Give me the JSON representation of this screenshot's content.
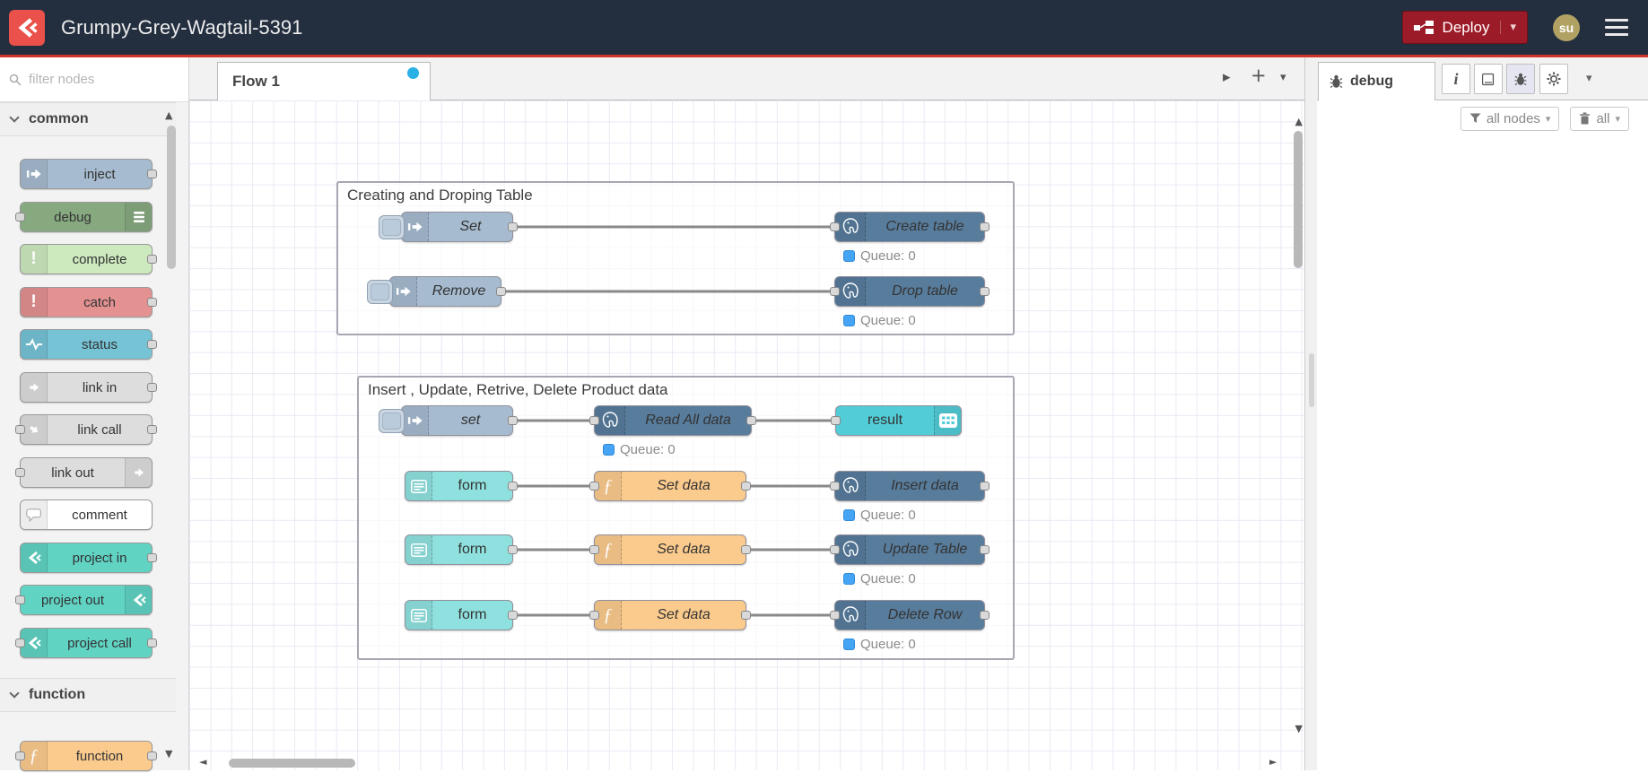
{
  "header": {
    "title": "Grumpy-Grey-Wagtail-5391",
    "deploy_label": "Deploy",
    "avatar_initials": "su",
    "colors": {
      "header_bg": "#232e3f",
      "header_underline": "#cf352c",
      "logo_red": "#e9514a",
      "deploy_red": "#9c1b28",
      "avatar_khaki": "#b1a264"
    }
  },
  "palette": {
    "filter_placeholder": "filter nodes",
    "categories": [
      {
        "label": "common",
        "nodes": [
          {
            "label": "inject",
            "color": "#a6bbcf"
          },
          {
            "label": "debug",
            "color": "#87a980"
          },
          {
            "label": "complete",
            "color": "#cdeabf"
          },
          {
            "label": "catch",
            "color": "#e49191"
          },
          {
            "label": "status",
            "color": "#76c3d6"
          },
          {
            "label": "link in",
            "color": "#dddddd"
          },
          {
            "label": "link call",
            "color": "#dddddd"
          },
          {
            "label": "link out",
            "color": "#dddddd"
          },
          {
            "label": "comment",
            "color": "#ffffff"
          },
          {
            "label": "project in",
            "color": "#60d3c3"
          },
          {
            "label": "project out",
            "color": "#60d3c3"
          },
          {
            "label": "project call",
            "color": "#60d3c3"
          }
        ]
      },
      {
        "label": "function",
        "nodes": [
          {
            "label": "function",
            "color": "#fbcb8e"
          }
        ]
      }
    ]
  },
  "workspace": {
    "tabs": [
      {
        "label": "Flow 1",
        "modified": true,
        "dot_color": "#29b1e6"
      }
    ],
    "groups": [
      {
        "title": "Creating and Droping Table"
      },
      {
        "title": "Insert , Update, Retrive, Delete Product data"
      }
    ],
    "nodes": [
      {
        "label": "Set",
        "type": "inject"
      },
      {
        "label": "Create table",
        "type": "postgresql",
        "status": "Queue: 0"
      },
      {
        "label": "Remove",
        "type": "inject"
      },
      {
        "label": "Drop table",
        "type": "postgresql",
        "status": "Queue: 0"
      },
      {
        "label": "set",
        "type": "inject"
      },
      {
        "label": "Read All data",
        "type": "postgresql",
        "status": "Queue: 0"
      },
      {
        "label": "result",
        "type": "table"
      },
      {
        "label": "form",
        "type": "form"
      },
      {
        "label": "Set data",
        "type": "function"
      },
      {
        "label": "Insert data",
        "type": "postgresql",
        "status": "Queue: 0"
      },
      {
        "label": "form",
        "type": "form"
      },
      {
        "label": "Set data",
        "type": "function"
      },
      {
        "label": "Update Table",
        "type": "postgresql",
        "status": "Queue: 0"
      },
      {
        "label": "form",
        "type": "form"
      },
      {
        "label": "Set data",
        "type": "function"
      },
      {
        "label": "Delete Row",
        "type": "postgresql",
        "status": "Queue: 0"
      }
    ],
    "status_dot_color": "#45a5f4",
    "node_colors": {
      "postgresql": "#587c9c",
      "function": "#fbcb8e",
      "form": "#8fe1df",
      "table": "#52ccd7",
      "inject": "#a6bbcf"
    }
  },
  "sidebar": {
    "tab_label": "debug",
    "filter_button_label": "all nodes",
    "clear_button_label": "all"
  },
  "icons": {
    "toolbar_expand": "▸",
    "toolbar_add": "+",
    "toolbar_menu": "▾",
    "deploy_caret": "▾",
    "sidebar_caret": "▾",
    "button_caret": "▾",
    "scroll_up": "▲",
    "scroll_down": "▼",
    "scroll_left": "◄",
    "scroll_right": "►",
    "info": "i"
  }
}
